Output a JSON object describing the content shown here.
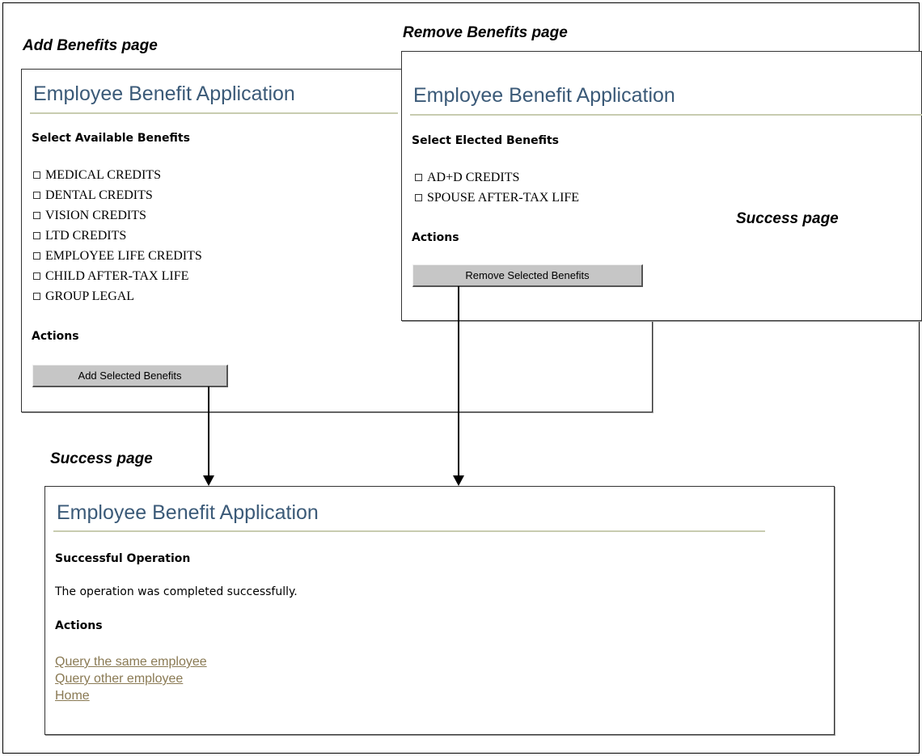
{
  "captions": {
    "add_page": "Add Benefits page",
    "remove_page": "Remove Benefits page",
    "success_page_small": "Success page",
    "success_page_main": "Success page"
  },
  "add_panel": {
    "app_title": "Employee Benefit Application",
    "section_heading": "Select Available Benefits",
    "benefits": [
      {
        "label": "MEDICAL CREDITS",
        "checked": false
      },
      {
        "label": "DENTAL CREDITS",
        "checked": false
      },
      {
        "label": "VISION CREDITS",
        "checked": false
      },
      {
        "label": "LTD CREDITS",
        "checked": false
      },
      {
        "label": "EMPLOYEE LIFE CREDITS",
        "checked": false
      },
      {
        "label": "CHILD AFTER-TAX LIFE",
        "checked": false
      },
      {
        "label": "GROUP LEGAL",
        "checked": false
      }
    ],
    "actions_heading": "Actions",
    "button_label": "Add Selected Benefits"
  },
  "remove_panel": {
    "app_title": "Employee Benefit Application",
    "section_heading": "Select Elected Benefits",
    "benefits": [
      {
        "label": "AD+D CREDITS",
        "checked": false
      },
      {
        "label": "SPOUSE AFTER-TAX LIFE",
        "checked": false
      }
    ],
    "actions_heading": "Actions",
    "button_label": "Remove Selected Benefits"
  },
  "success_panel": {
    "app_title": "Employee Benefit Application",
    "heading": "Successful Operation",
    "message": "The operation was completed successfully.",
    "actions_heading": "Actions",
    "links": [
      {
        "label": "Query the same employee"
      },
      {
        "label": "Query other employee"
      },
      {
        "label": "Home"
      }
    ]
  },
  "colors": {
    "title_blue": "#3b5a78",
    "rule": "#c8ccb0",
    "link": "#8a7a54",
    "button": "#c6c6c6"
  }
}
